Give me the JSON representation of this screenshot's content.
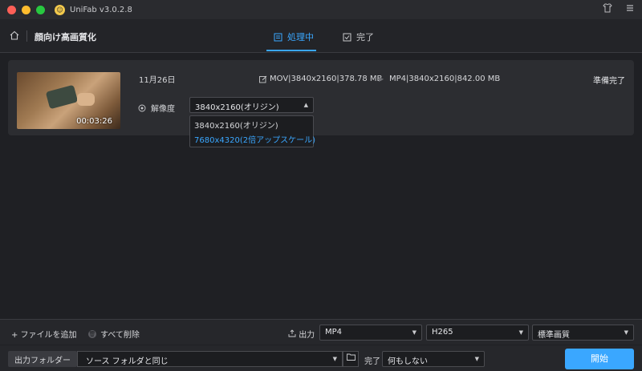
{
  "app": {
    "title": "UniFab v3.0.2.8"
  },
  "header": {
    "page_title": "顔向け高画質化",
    "tabs": [
      {
        "label": "処理中",
        "active": true
      },
      {
        "label": "完了",
        "active": false
      }
    ]
  },
  "task": {
    "duration": "00:03:26",
    "date": "11月26日",
    "source_info": "MOV|3840x2160|378.78 MB",
    "output_info": "MP4|3840x2160|842.00 MB",
    "status": "準備完了",
    "resolution_label": "解像度",
    "resolution_selected": "3840x2160(オリジン)",
    "resolution_options": [
      {
        "label": "3840x2160(オリジン)"
      },
      {
        "label": "7680x4320(2倍アップスケール)",
        "highlighted": true
      }
    ]
  },
  "toolbar": {
    "add_file": "+ ファイルを追加",
    "delete_all": "すべて削除",
    "output_label": "出力",
    "format": "MP4",
    "codec": "H265",
    "quality": "標準画質"
  },
  "footer": {
    "folder_label": "出力フォルダー",
    "folder_value": "ソース フォルダと同じ",
    "done_label": "完了",
    "done_action": "何もしない",
    "start_button": "開始"
  },
  "colors": {
    "accent": "#3aa7ff",
    "background": "#1f2024"
  }
}
